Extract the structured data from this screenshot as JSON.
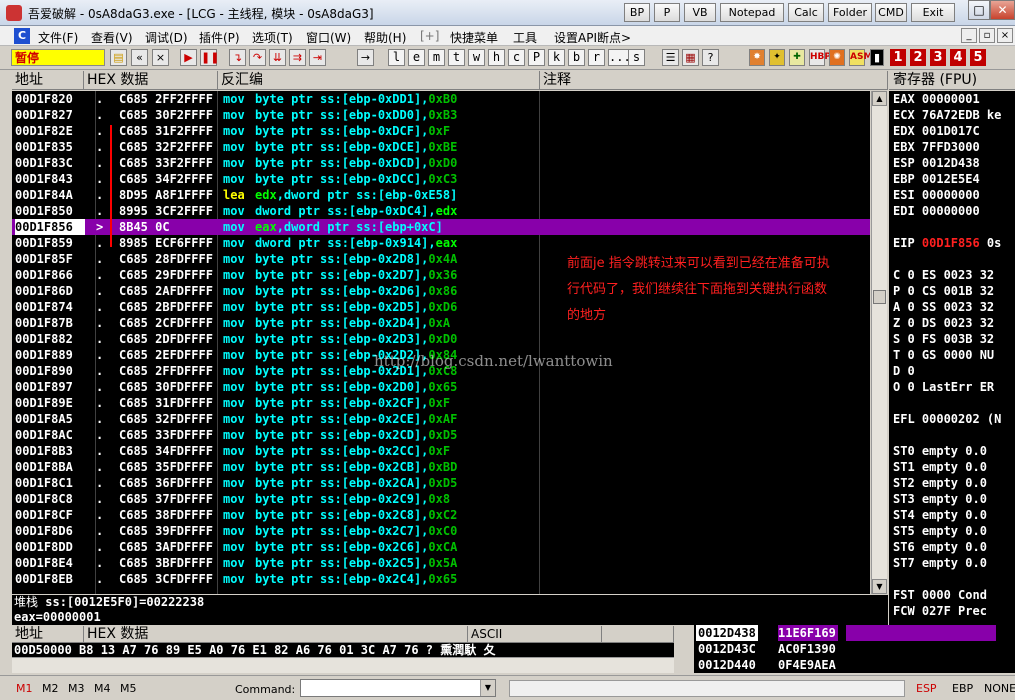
{
  "window": {
    "title": "吾爱破解 - 0sA8daG3.exe - [LCG - 主线程, 模块 - 0sA8daG3]",
    "plugin_buttons": [
      "BP",
      "P",
      "VB",
      "Notepad",
      "Calc",
      "Folder",
      "CMD",
      "Exit"
    ],
    "controls": [
      "–",
      "□",
      "✕"
    ]
  },
  "menu": {
    "items": [
      "文件(F)",
      "查看(V)",
      "调试(D)",
      "插件(P)",
      "选项(T)",
      "窗口(W)",
      "帮助(H)",
      "[+]",
      "快捷菜单",
      "工具",
      "设置API断点>"
    ]
  },
  "toolbar": {
    "status": "暂停",
    "letters": [
      "l",
      "e",
      "m",
      "t",
      "w",
      "h",
      "c",
      "P",
      "k",
      "b",
      "r",
      "...",
      "s"
    ],
    "numbers": [
      "1",
      "2",
      "3",
      "4",
      "5"
    ],
    "plugin_icons": [
      "HBP",
      "ASM"
    ]
  },
  "disasm": {
    "headers": {
      "addr": "地址",
      "hex": "HEX 数据",
      "asm": "反汇编",
      "comment": "注释"
    },
    "rows": [
      {
        "addr": "00D1F820",
        "mark": ".",
        "hex": "C685 2FF2FFFF",
        "mn": "mov",
        "op": "byte ptr ss:[ebp-0xDD1],",
        "val": "0xB0"
      },
      {
        "addr": "00D1F827",
        "mark": ".",
        "hex": "C685 30F2FFFF",
        "mn": "mov",
        "op": "byte ptr ss:[ebp-0xDD0],",
        "val": "0xB3"
      },
      {
        "addr": "00D1F82E",
        "mark": ".",
        "hex": "C685 31F2FFFF",
        "mn": "mov",
        "op": "byte ptr ss:[ebp-0xDCF],",
        "val": "0xF"
      },
      {
        "addr": "00D1F835",
        "mark": ".",
        "hex": "C685 32F2FFFF",
        "mn": "mov",
        "op": "byte ptr ss:[ebp-0xDCE],",
        "val": "0xBE"
      },
      {
        "addr": "00D1F83C",
        "mark": ".",
        "hex": "C685 33F2FFFF",
        "mn": "mov",
        "op": "byte ptr ss:[ebp-0xDCD],",
        "val": "0xD0"
      },
      {
        "addr": "00D1F843",
        "mark": ".",
        "hex": "C685 34F2FFFF",
        "mn": "mov",
        "op": "byte ptr ss:[ebp-0xDCC],",
        "val": "0xC3"
      },
      {
        "addr": "00D1F84A",
        "mark": ".",
        "hex": "8D95 A8F1FFFF",
        "mn": "lea",
        "reg": "edx",
        "op": ",dword ptr ss:[ebp-0xE58]",
        "val": ""
      },
      {
        "addr": "00D1F850",
        "mark": ".",
        "hex": "8995 3CF2FFFF",
        "mn": "mov",
        "op": "dword ptr ss:[ebp-0xDC4],",
        "val": "",
        "reg2": "edx"
      },
      {
        "addr": "00D1F856",
        "mark": ">",
        "hex": "8B45 0C",
        "mn": "mov",
        "reg": "eax",
        "op": ",dword ptr ss:[ebp+0xC]",
        "val": "",
        "sel": true
      },
      {
        "addr": "00D1F859",
        "mark": ".",
        "hex": "8985 ECF6FFFF",
        "mn": "mov",
        "op": "dword ptr ss:[ebp-0x914],",
        "val": "",
        "reg2": "eax"
      },
      {
        "addr": "00D1F85F",
        "mark": ".",
        "hex": "C685 28FDFFFF",
        "mn": "mov",
        "op": "byte ptr ss:[ebp-0x2D8],",
        "val": "0x4A"
      },
      {
        "addr": "00D1F866",
        "mark": ".",
        "hex": "C685 29FDFFFF",
        "mn": "mov",
        "op": "byte ptr ss:[ebp-0x2D7],",
        "val": "0x36"
      },
      {
        "addr": "00D1F86D",
        "mark": ".",
        "hex": "C685 2AFDFFFF",
        "mn": "mov",
        "op": "byte ptr ss:[ebp-0x2D6],",
        "val": "0x86"
      },
      {
        "addr": "00D1F874",
        "mark": ".",
        "hex": "C685 2BFDFFFF",
        "mn": "mov",
        "op": "byte ptr ss:[ebp-0x2D5],",
        "val": "0xD6"
      },
      {
        "addr": "00D1F87B",
        "mark": ".",
        "hex": "C685 2CFDFFFF",
        "mn": "mov",
        "op": "byte ptr ss:[ebp-0x2D4],",
        "val": "0xA"
      },
      {
        "addr": "00D1F882",
        "mark": ".",
        "hex": "C685 2DFDFFFF",
        "mn": "mov",
        "op": "byte ptr ss:[ebp-0x2D3],",
        "val": "0xD0"
      },
      {
        "addr": "00D1F889",
        "mark": ".",
        "hex": "C685 2EFDFFFF",
        "mn": "mov",
        "op": "byte ptr ss:[ebp-0x2D2],",
        "val": "0x84"
      },
      {
        "addr": "00D1F890",
        "mark": ".",
        "hex": "C685 2FFDFFFF",
        "mn": "mov",
        "op": "byte ptr ss:[ebp-0x2D1],",
        "val": "0xC8"
      },
      {
        "addr": "00D1F897",
        "mark": ".",
        "hex": "C685 30FDFFFF",
        "mn": "mov",
        "op": "byte ptr ss:[ebp-0x2D0],",
        "val": "0x65"
      },
      {
        "addr": "00D1F89E",
        "mark": ".",
        "hex": "C685 31FDFFFF",
        "mn": "mov",
        "op": "byte ptr ss:[ebp-0x2CF],",
        "val": "0xF"
      },
      {
        "addr": "00D1F8A5",
        "mark": ".",
        "hex": "C685 32FDFFFF",
        "mn": "mov",
        "op": "byte ptr ss:[ebp-0x2CE],",
        "val": "0xAF"
      },
      {
        "addr": "00D1F8AC",
        "mark": ".",
        "hex": "C685 33FDFFFF",
        "mn": "mov",
        "op": "byte ptr ss:[ebp-0x2CD],",
        "val": "0xD5"
      },
      {
        "addr": "00D1F8B3",
        "mark": ".",
        "hex": "C685 34FDFFFF",
        "mn": "mov",
        "op": "byte ptr ss:[ebp-0x2CC],",
        "val": "0xF"
      },
      {
        "addr": "00D1F8BA",
        "mark": ".",
        "hex": "C685 35FDFFFF",
        "mn": "mov",
        "op": "byte ptr ss:[ebp-0x2CB],",
        "val": "0xBD"
      },
      {
        "addr": "00D1F8C1",
        "mark": ".",
        "hex": "C685 36FDFFFF",
        "mn": "mov",
        "op": "byte ptr ss:[ebp-0x2CA],",
        "val": "0xD5"
      },
      {
        "addr": "00D1F8C8",
        "mark": ".",
        "hex": "C685 37FDFFFF",
        "mn": "mov",
        "op": "byte ptr ss:[ebp-0x2C9],",
        "val": "0x8"
      },
      {
        "addr": "00D1F8CF",
        "mark": ".",
        "hex": "C685 38FDFFFF",
        "mn": "mov",
        "op": "byte ptr ss:[ebp-0x2C8],",
        "val": "0xC2"
      },
      {
        "addr": "00D1F8D6",
        "mark": ".",
        "hex": "C685 39FDFFFF",
        "mn": "mov",
        "op": "byte ptr ss:[ebp-0x2C7],",
        "val": "0xC0"
      },
      {
        "addr": "00D1F8DD",
        "mark": ".",
        "hex": "C685 3AFDFFFF",
        "mn": "mov",
        "op": "byte ptr ss:[ebp-0x2C6],",
        "val": "0xCA"
      },
      {
        "addr": "00D1F8E4",
        "mark": ".",
        "hex": "C685 3BFDFFFF",
        "mn": "mov",
        "op": "byte ptr ss:[ebp-0x2C5],",
        "val": "0x5A"
      },
      {
        "addr": "00D1F8EB",
        "mark": ".",
        "hex": "C685 3CFDFFFF",
        "mn": "mov",
        "op": "byte ptr ss:[ebp-0x2C4],",
        "val": "0x65"
      }
    ],
    "annotation": "前面je 指令跳转过来可以看到已经在准备可执行代码了，我们继续往下面拖到关键执行函数的地方",
    "watermark": "http://blog.csdn.net/lwanttowin"
  },
  "info": {
    "label": "堆栈",
    "line1": "ss:[0012E5F0]=00222238",
    "line2": "eax=00000001"
  },
  "registers": {
    "header": "寄存器 (FPU)",
    "lines": [
      "EAX 00000001",
      "ECX 76A72EDB ke",
      "EDX 001D017C",
      "EBX 7FFD3000",
      "ESP 0012D438",
      "EBP 0012E5E4",
      "ESI 00000000",
      "EDI 00000000",
      "",
      "EIP |00D1F856| 0s",
      "",
      "C 0  ES 0023 32",
      "P 0  CS 001B 32",
      "A 0  SS 0023 32",
      "Z 0  DS 0023 32",
      "S 0  FS 003B 32",
      "T 0  GS 0000 NU",
      "D 0",
      "O 0  LastErr ER",
      "",
      "EFL 00000202 (N",
      "",
      "ST0 empty 0.0",
      "ST1 empty 0.0",
      "ST2 empty 0.0",
      "ST3 empty 0.0",
      "ST4 empty 0.0",
      "ST5 empty 0.0",
      "ST6 empty 0.0",
      "ST7 empty 0.0",
      "",
      "FST 0000  Cond",
      "FCW 027F  Prec"
    ]
  },
  "dump": {
    "headers": {
      "addr": "地址",
      "hex": "HEX 数据",
      "ascii": "ASCII"
    },
    "row": "00D50000 B8 13 A7 76 89 E5 A0 76 E1 82 A6 76 01 3C A7 76 ?  熏潤馱  夂"
  },
  "stack": {
    "rows": [
      {
        "addr": "0012D438",
        "val": "11E6F169",
        "sel": true
      },
      {
        "addr": "0012D43C",
        "val": "AC0F1390"
      },
      {
        "addr": "0012D440",
        "val": "0F4E9AEA"
      }
    ]
  },
  "statusbar": {
    "marks": [
      "M1",
      "M2",
      "M3",
      "M4",
      "M5"
    ],
    "command_label": "Command:",
    "command_value": "",
    "right": [
      "ESP",
      "EBP",
      "NONE"
    ]
  }
}
